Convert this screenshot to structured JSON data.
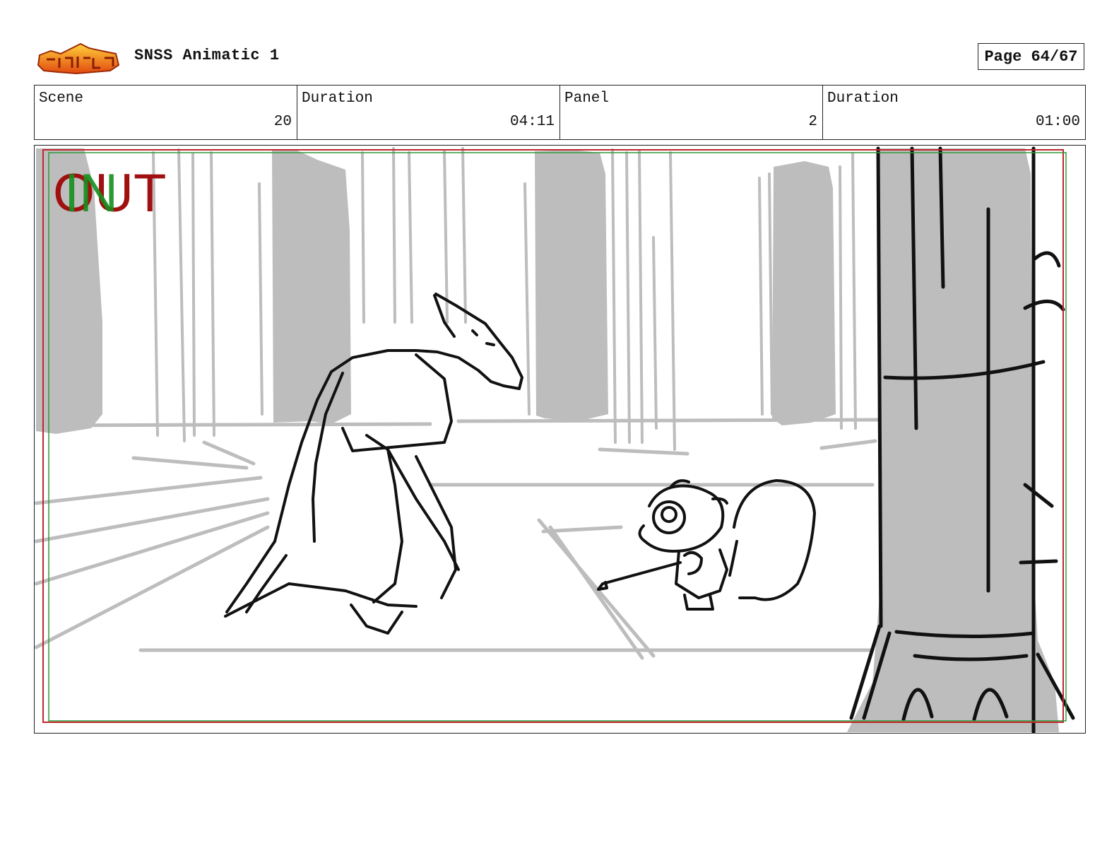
{
  "header": {
    "logo_text": "Star vs Forces of Evil",
    "project_title": "SNSS Animatic 1",
    "page_label": "Page 64/67"
  },
  "info": {
    "scene_label": "Scene",
    "scene_value": "20",
    "scene_duration_label": "Duration",
    "scene_duration_value": "04:11",
    "panel_label": "Panel",
    "panel_value": "2",
    "panel_duration_label": "Duration",
    "panel_duration_value": "01:00"
  },
  "panel": {
    "out_marker": "OUT",
    "in_marker": "IN",
    "colors": {
      "safe_frame": "#c0262d",
      "action_frame": "#2e9a3a",
      "sketch_gray": "#bdbdbd",
      "ink": "#111111"
    }
  }
}
